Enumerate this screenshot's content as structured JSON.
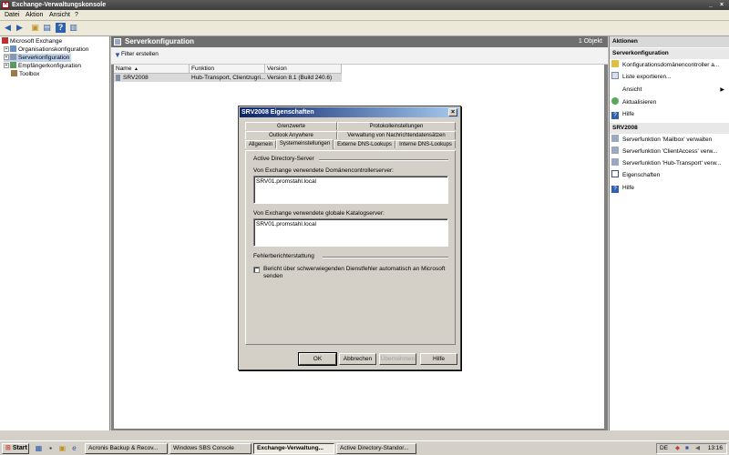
{
  "window": {
    "title": "Exchange-Verwaltungskonsole"
  },
  "menu": {
    "items": [
      "Datei",
      "Aktion",
      "Ansicht",
      "?"
    ]
  },
  "tree": {
    "root": "Microsoft Exchange",
    "items": [
      "Organisationskonfiguration",
      "Serverkonfiguration",
      "Empfängerkonfiguration",
      "Toolbox"
    ]
  },
  "center": {
    "header": "Serverkonfiguration",
    "count": "1 Objekt",
    "filter_label": "Filter erstellen",
    "columns": [
      "Name",
      "Funktion",
      "Version"
    ],
    "rows": [
      {
        "name": "SRV2008",
        "function": "Hub-Transport, Clientzugri...",
        "version": "Version 8.1 (Build 240.6)"
      }
    ]
  },
  "actions": {
    "header": "Aktionen",
    "section1": "Serverkonfiguration",
    "section1_items": [
      "Konfigurationsdomänencontroller a...",
      "Liste exportieren...",
      "Ansicht",
      "Aktualisieren",
      "Hilfe"
    ],
    "section2": "SRV2008",
    "section2_items": [
      "Serverfunktion 'Mailbox' verwalten",
      "Serverfunktion 'ClientAccess' verw...",
      "Serverfunktion 'Hub-Transport' verw...",
      "Eigenschaften",
      "Hilfe"
    ]
  },
  "dialog": {
    "title": "SRV2008 Eigenschaften",
    "close": "×",
    "tabs_row1": [
      "Grenzwerte",
      "Protokolleinstellungen"
    ],
    "tabs_row2": [
      "Outlook Anywhere",
      "Verwaltung von Nachrichtendatensätzen"
    ],
    "tabs_row3": [
      "Allgemein",
      "Systemeinstellungen",
      "Externe DNS-Lookups",
      "Interne DNS-Lookups"
    ],
    "group1": "Active Directory-Server",
    "dc_label": "Von Exchange verwendete Domänencontrollerserver:",
    "dc_value": "SRV01.promstahl.local",
    "gc_label": "Von Exchange verwendete globale Katalogserver:",
    "gc_value": "SRV01.promstahl.local",
    "group2": "Fehlerberichterstattung",
    "checkbox_label_1": "Bericht über schwerwiegenden Dienstfehler automatisch an Microsoft",
    "checkbox_label_2": "senden",
    "buttons": {
      "ok": "OK",
      "cancel": "Abbrechen",
      "apply": "Übernehmen",
      "help": "Hilfe"
    }
  },
  "taskbar": {
    "start": "Start",
    "tasks": [
      "Acronis Backup & Recov...",
      "Windows SBS Console",
      "Exchange-Verwaltung...",
      "Active Directory-Standor..."
    ],
    "lang": "DE",
    "clock": "13:16"
  }
}
